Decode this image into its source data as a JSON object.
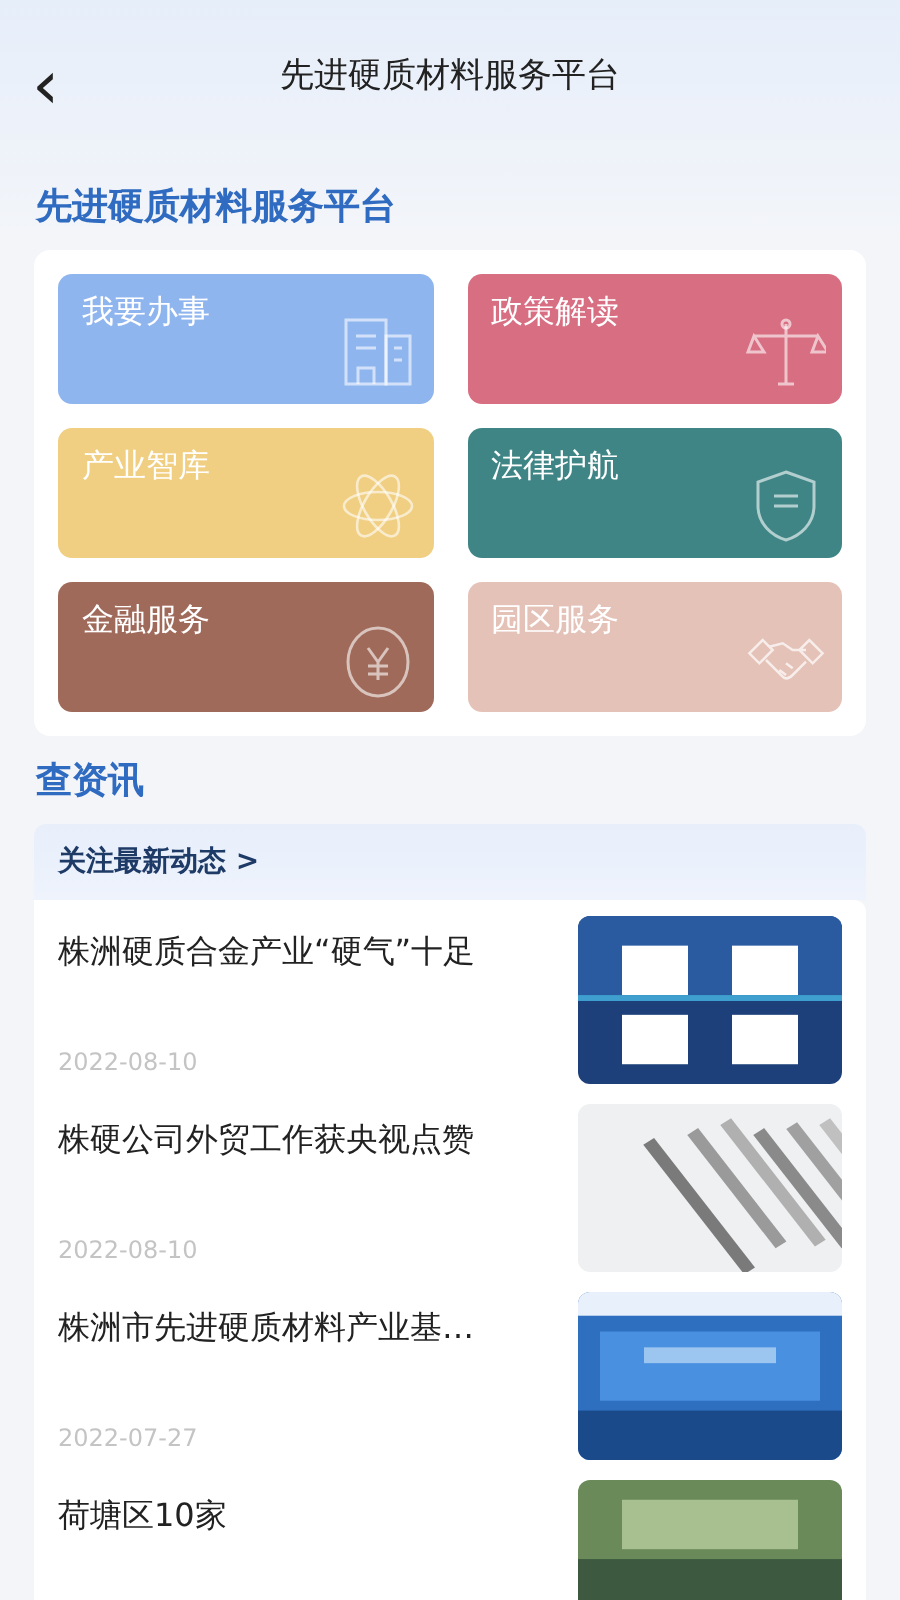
{
  "header": {
    "back": "‹",
    "title": "先进硬质材料服务平台"
  },
  "services": {
    "title": "先进硬质材料服务平台",
    "tiles": [
      {
        "label": "我要办事",
        "color": "#8fb5ef",
        "kind": "building"
      },
      {
        "label": "政策解读",
        "color": "#d86e82",
        "kind": "scale"
      },
      {
        "label": "产业智库",
        "color": "#f0cf82",
        "kind": "atom"
      },
      {
        "label": "法律护航",
        "color": "#3f8585",
        "kind": "shield"
      },
      {
        "label": "金融服务",
        "color": "#a06a5a",
        "kind": "money"
      },
      {
        "label": "园区服务",
        "color": "#e5c2b8",
        "kind": "handshake"
      }
    ]
  },
  "news": {
    "title": "查资讯",
    "banner": "关注最新动态 >",
    "items": [
      {
        "title": "株洲硬质合金产业“硬气”十足",
        "date": "2022-08-10",
        "kind": "picture"
      },
      {
        "title": "株硬公司外贸工作获央视点赞",
        "date": "2022-08-10",
        "kind": "picture"
      },
      {
        "title": "株洲市先进硬质材料产业基…",
        "date": "2022-07-27",
        "kind": "picture"
      },
      {
        "title": "荷塘区10家",
        "kind": "picture"
      }
    ]
  }
}
